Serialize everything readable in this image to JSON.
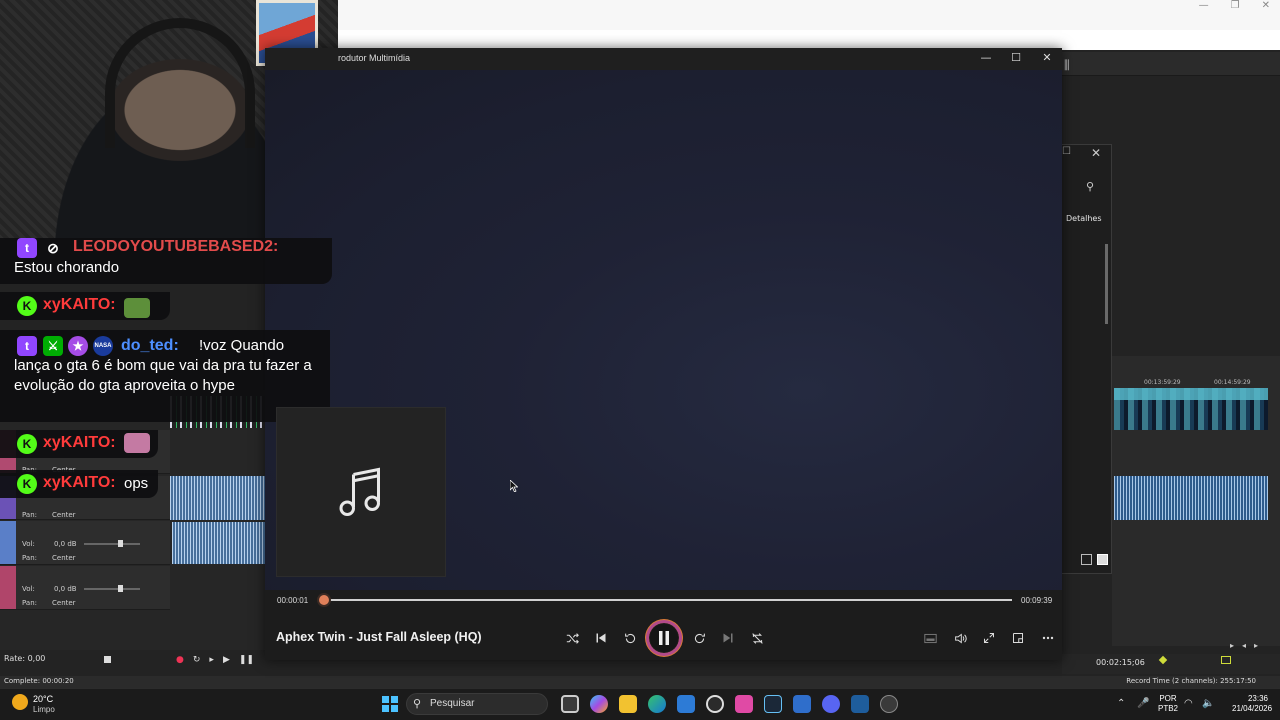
{
  "background_app": {
    "detail_tab": "Detalhes",
    "ruler_times": [
      "00:13:59:29",
      "00:14:59:29"
    ],
    "transport_time": "00:02:15;06",
    "rate": "Rate: 0,00",
    "status_left": "Complete: 00:00:20",
    "status_right": "Record Time (2 channels): 255:17:50",
    "tracks": [
      {
        "vol": "0,0 dB",
        "pan": "Center"
      },
      {
        "vol": "0,0 dB",
        "pan": "Center"
      },
      {
        "vol": "0,0 dB",
        "pan": "Center"
      }
    ]
  },
  "chat": {
    "messages": [
      {
        "user": "LEODOYOUTUBEBASED2:",
        "user_color": "#e24b4b",
        "text": "Estou chorando"
      },
      {
        "user": "xyKAITO:",
        "user_color": "#ff3b3b",
        "text": ""
      },
      {
        "user": "do_ted:",
        "user_color": "#4d8fff",
        "text": "!voz Quando lança o gta 6 é bom que vai da pra tu fazer a evolução do gta aproveita o hype"
      },
      {
        "user": "xyKAITO:",
        "user_color": "#ff3b3b",
        "text": ""
      },
      {
        "user": "xyKAITO:",
        "user_color": "#ff3b3b",
        "text": "ops"
      }
    ]
  },
  "player": {
    "window_title": "rodutor Multimídia",
    "track_title": "Aphex Twin - Just Fall Asleep (HQ)",
    "elapsed": "00:00:01",
    "duration": "00:09:39",
    "progress": 0.002,
    "accent": "#e0805a",
    "icons": {
      "shuffle": "shuffle-icon",
      "previous": "previous-icon",
      "rewind": "rewind-10-icon",
      "play_pause": "pause-icon",
      "forward": "forward-30-icon",
      "next": "next-icon",
      "repeat": "repeat-off-icon",
      "cast": "cast-icon",
      "volume": "volume-icon",
      "fullscreen": "fullscreen-icon",
      "miniplayer": "miniplayer-icon",
      "more": "more-icon"
    }
  },
  "taskbar": {
    "temperature": "20°C",
    "condition": "Limpo",
    "search_placeholder": "Pesquisar",
    "lang_1": "POR",
    "lang_2": "PTB2",
    "time": "23:36",
    "date": "21/04/2026"
  }
}
